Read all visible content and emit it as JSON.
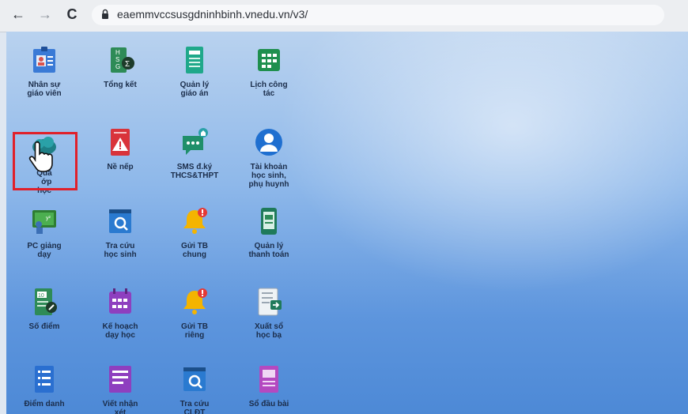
{
  "browser": {
    "url": "eaemmvccsusgdninhbinh.vnedu.vn/v3/",
    "back_glyph": "←",
    "forward_glyph": "→",
    "reload_glyph": "C"
  },
  "apps": [
    {
      "id": "nhan-su",
      "label": "Nhân sự\ngiáo viên",
      "icon": "id-card-icon"
    },
    {
      "id": "tong-ket",
      "label": "Tổng kết",
      "icon": "hsg-sigma-icon"
    },
    {
      "id": "quan-ly-giao-an",
      "label": "Quản lý\ngiáo án",
      "icon": "lesson-doc-icon"
    },
    {
      "id": "lich-cong-tac",
      "label": "Lịch công\ntác",
      "icon": "calendar-grid-icon"
    },
    {
      "id": "quan-ly-lop-hoc",
      "label": "Quả\n  ớp\nhọc",
      "icon": "class-cloud-icon"
    },
    {
      "id": "ne-nep",
      "label": "Nề nếp",
      "icon": "warning-doc-icon"
    },
    {
      "id": "sms",
      "label": "SMS đ.ký\nTHCS&THPT",
      "icon": "sms-chat-icon"
    },
    {
      "id": "tai-khoan",
      "label": "Tài khoản\nhọc sinh,\nphụ huynh",
      "icon": "user-avatar-icon"
    },
    {
      "id": "pc-giang-day",
      "label": "PC giảng\ndạy",
      "icon": "teacher-board-icon"
    },
    {
      "id": "tra-cuu-hoc-sinh",
      "label": "Tra cứu\nhọc sinh",
      "icon": "search-window-icon"
    },
    {
      "id": "gui-tb-chung",
      "label": "Gửi TB\nchung",
      "icon": "bell-badge-icon"
    },
    {
      "id": "quan-ly-thanh-toan",
      "label": "Quản lý\nthanh toán",
      "icon": "payment-phone-icon"
    },
    {
      "id": "so-diem",
      "label": "Số điểm",
      "icon": "grade-book-icon"
    },
    {
      "id": "ke-hoach-day-hoc",
      "label": "Kế hoạch\ndạy học",
      "icon": "plan-calendar-icon"
    },
    {
      "id": "gui-tb-rieng",
      "label": "Gửi TB\nriêng",
      "icon": "bell-badge-icon"
    },
    {
      "id": "xuat-so-hoc-ba",
      "label": "Xuất sổ\nhọc bạ",
      "icon": "export-doc-icon"
    },
    {
      "id": "diem-danh",
      "label": "Điểm danh",
      "icon": "attendance-list-icon"
    },
    {
      "id": "viet-nhan-xet",
      "label": "Viết nhận\nxét",
      "icon": "comment-list-icon"
    },
    {
      "id": "tra-cuu-cldt",
      "label": "Tra cứu\nCLĐT",
      "icon": "search-window-icon"
    },
    {
      "id": "so-dau-bai",
      "label": "Sổ đầu bài",
      "icon": "register-book-icon"
    }
  ],
  "highlight": {
    "target": "quan-ly-lop-hoc",
    "color": "#e0202a"
  },
  "colors": {
    "desktop_top": "#b9d2ef",
    "desktop_bottom": "#4d89d6",
    "label": "#1b2d4a"
  }
}
